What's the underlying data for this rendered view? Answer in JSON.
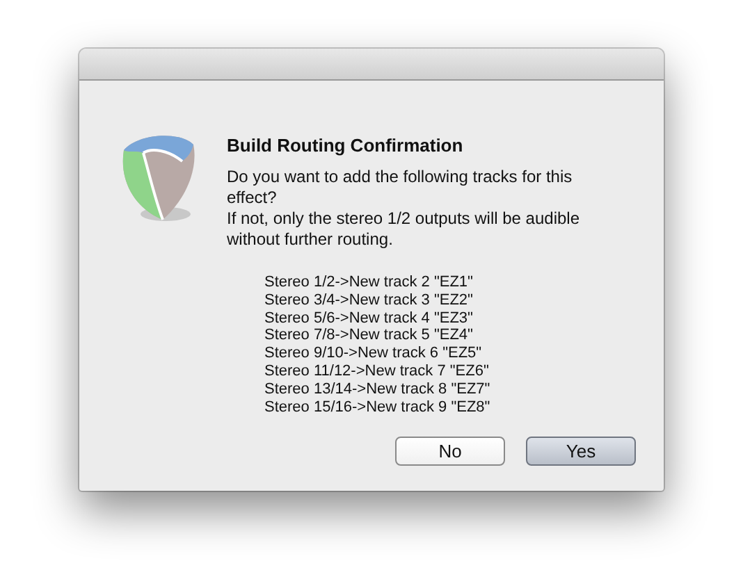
{
  "dialog": {
    "title": "Build Routing Confirmation",
    "message_lines": [
      "Do you want to add the following tracks for this",
      "effect?",
      "If not, only the stereo 1/2 outputs will be audible",
      "without further routing."
    ],
    "tracks": [
      "Stereo 1/2->New track 2 \"EZ1\"",
      "Stereo 3/4->New track 3 \"EZ2\"",
      "Stereo 5/6->New track 4 \"EZ3\"",
      "Stereo 7/8->New track 5 \"EZ4\"",
      "Stereo 9/10->New track 6 \"EZ5\"",
      "Stereo 11/12->New track 7 \"EZ6\"",
      "Stereo 13/14->New track 8 \"EZ7\"",
      "Stereo 15/16->New track 9 \"EZ8\""
    ],
    "buttons": [
      {
        "label": "No",
        "default": false
      },
      {
        "label": "Yes",
        "default": true
      }
    ]
  }
}
